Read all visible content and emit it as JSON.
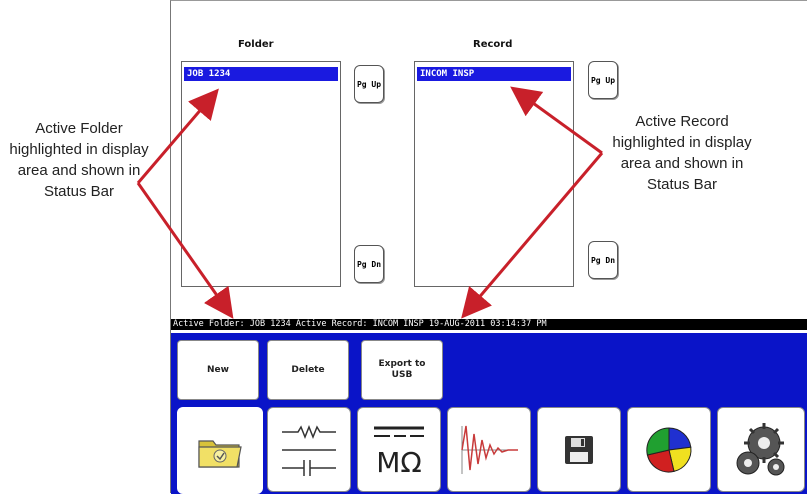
{
  "folder": {
    "title": "Folder",
    "items": [
      "JOB 1234"
    ],
    "pgup": "Pg Up",
    "pgdn": "Pg Dn"
  },
  "record": {
    "title": "Record",
    "items": [
      "INCOM INSP"
    ],
    "pgup": "Pg Up",
    "pgdn": "Pg Dn"
  },
  "status_bar": {
    "text": "Active Folder: JOB 1234    Active Record: INCOM INSP  19-AUG-2011 03:14:37 PM"
  },
  "actions": {
    "new": "New",
    "delete": "Delete",
    "export": "Export to USB"
  },
  "toolbar": {
    "items": [
      {
        "name": "folders",
        "icon": "folder-icon",
        "active": true
      },
      {
        "name": "circuit",
        "icon": "circuit-icon"
      },
      {
        "name": "megohm",
        "icon": "megohm-icon",
        "label": "MΩ"
      },
      {
        "name": "waveform",
        "icon": "waveform-icon"
      },
      {
        "name": "save",
        "icon": "floppy-disk-icon"
      },
      {
        "name": "pie",
        "icon": "pie-chart-icon"
      },
      {
        "name": "settings",
        "icon": "gears-icon"
      }
    ]
  },
  "callouts": {
    "left": "Active Folder highlighted in display area and shown in Status Bar",
    "right": "Active Record highlighted in display area and shown in Status Bar"
  },
  "colors": {
    "highlight": "#1a1ae0",
    "panel": "#0a14c8",
    "arrow": "#c8202a",
    "status_bar": "#000000"
  }
}
